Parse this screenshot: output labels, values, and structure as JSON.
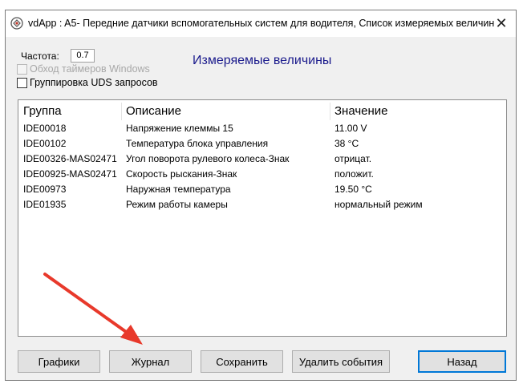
{
  "window": {
    "title": "vdApp : A5- Передние датчики вспомогательных систем для водителя,  Список измеряемых величин",
    "close_glyph": "✕"
  },
  "settings": {
    "frequency_label": "Частота:",
    "frequency_value": "0.7",
    "bypass_timers_label": "Обход таймеров Windows",
    "group_uds_label": "Группировка UDS запросов"
  },
  "section_title": "Измеряемые величины",
  "table": {
    "columns": [
      "Группа",
      "Описание",
      "Значение"
    ],
    "rows": [
      {
        "group": "IDE00018",
        "description": "Напряжение клеммы 15",
        "value": "11.00 V"
      },
      {
        "group": "IDE00102",
        "description": "Температура блока управления",
        "value": "38 °C"
      },
      {
        "group": "IDE00326-MAS02471",
        "description": "Угол поворота рулевого колеса-Знак",
        "value": "отрицат."
      },
      {
        "group": "IDE00925-MAS02471",
        "description": "Скорость рыскания-Знак",
        "value": "положит."
      },
      {
        "group": "IDE00973",
        "description": "Наружная температура",
        "value": "19.50 °C"
      },
      {
        "group": "IDE01935",
        "description": "Режим работы камеры",
        "value": "нормальный режим"
      }
    ]
  },
  "buttons": {
    "charts": "Графики",
    "journal": "Журнал",
    "save": "Сохранить",
    "delete_events": "Удалить события",
    "back": "Назад"
  },
  "annotation": {
    "arrow_color": "#e8392b"
  }
}
